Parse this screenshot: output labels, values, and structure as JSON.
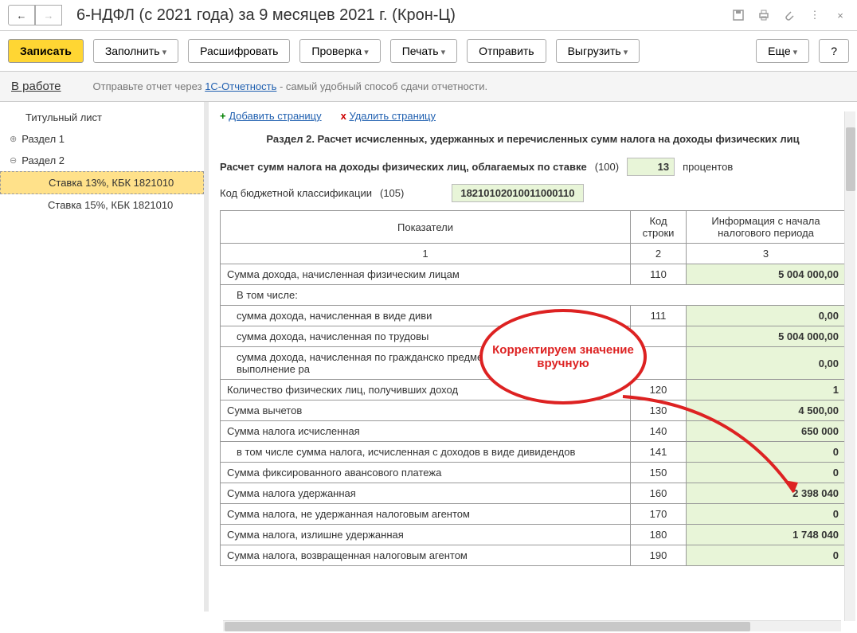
{
  "window_title": "6-НДФЛ (с 2021 года) за 9 месяцев 2021 г. (Крон-Ц)",
  "toolbar": {
    "write": "Записать",
    "fill": "Заполнить",
    "decode": "Расшифровать",
    "check": "Проверка",
    "print": "Печать",
    "send": "Отправить",
    "export": "Выгрузить",
    "more": "Еще",
    "help": "?"
  },
  "status": {
    "state": "В работе",
    "msg_pre": "Отправьте отчет через ",
    "msg_link": "1С-Отчетность",
    "msg_post": " - самый удобный способ сдачи отчетности."
  },
  "tree": {
    "title_page": "Титульный лист",
    "section1": "Раздел 1",
    "section2": "Раздел 2",
    "rate13": "Ставка 13%, КБК 1821010",
    "rate15": "Ставка 15%, КБК 1821010"
  },
  "page_actions": {
    "add": "Добавить страницу",
    "del": "Удалить страницу"
  },
  "section_header": "Раздел 2. Расчет исчисленных, удержанных и перечисленных сумм налога на доходы физических лиц",
  "rate_line": {
    "label": "Расчет сумм налога на доходы физических лиц, облагаемых по ставке",
    "code": "(100)",
    "value": "13",
    "suffix": "процентов"
  },
  "kbk_line": {
    "label": "Код бюджетной классификации",
    "code": "(105)",
    "value": "18210102010011000110"
  },
  "grid": {
    "headers": {
      "col1": "Показатели",
      "col2": "Код строки",
      "col3": "Информация с начала налогового периода"
    },
    "subheaders": {
      "c1": "1",
      "c2": "2",
      "c3": "3"
    },
    "rows": [
      {
        "label": "Сумма дохода, начисленная физическим лицам",
        "code": "110",
        "val": "5 004 000,00",
        "indent": false
      },
      {
        "label": "В том числе:",
        "code": "",
        "val": "",
        "indent": true,
        "noval": true
      },
      {
        "label": "сумма дохода, начисленная в виде диви",
        "code": "111",
        "val": "0,00",
        "indent": true
      },
      {
        "label": "сумма дохода, начисленная по трудовы",
        "code": "",
        "val": "5 004 000,00",
        "indent": true
      },
      {
        "label": "сумма дохода, начисленная по гражданско предметом которых являются выполнение ра",
        "code": "",
        "val": "0,00",
        "indent": true
      },
      {
        "label": "Количество физических лиц, получивших доход",
        "code": "120",
        "val": "1",
        "indent": false
      },
      {
        "label": "Сумма вычетов",
        "code": "130",
        "val": "4 500,00",
        "indent": false
      },
      {
        "label": "Сумма налога исчисленная",
        "code": "140",
        "val": "650 000",
        "indent": false
      },
      {
        "label": "в том числе сумма налога, исчисленная с доходов в виде дивидендов",
        "code": "141",
        "val": "0",
        "indent": true
      },
      {
        "label": "Сумма фиксированного авансового платежа",
        "code": "150",
        "val": "0",
        "indent": false
      },
      {
        "label": "Сумма налога удержанная",
        "code": "160",
        "val": "2 398 040",
        "indent": false
      },
      {
        "label": "Сумма налога, не удержанная налоговым агентом",
        "code": "170",
        "val": "0",
        "indent": false
      },
      {
        "label": "Сумма налога, излишне удержанная",
        "code": "180",
        "val": "1 748 040",
        "indent": false
      },
      {
        "label": "Сумма налога, возвращенная налоговым агентом",
        "code": "190",
        "val": "0",
        "indent": false
      }
    ]
  },
  "callout": "Корректируем значение вручную"
}
